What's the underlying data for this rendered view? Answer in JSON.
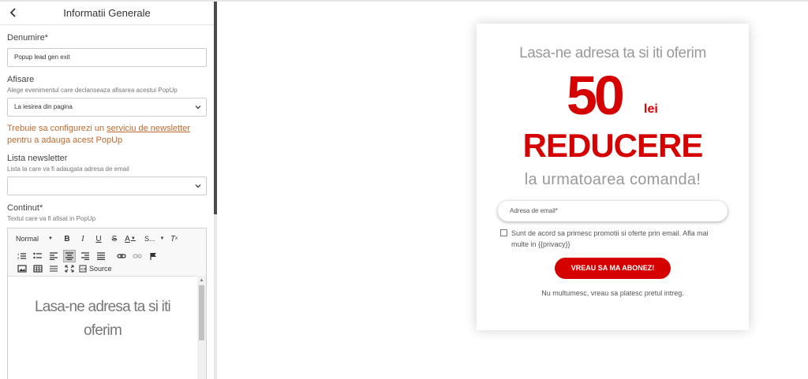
{
  "panel": {
    "title": "Informatii Generale",
    "back_icon": "chevron-left-icon",
    "name_label": "Denumire*",
    "name_value": "Popup lead gen exit",
    "display_label": "Afisare",
    "display_hint": "Alege evenimentul care declanseaza afisarea acestui PopUp",
    "display_value": "La iesirea din pagina",
    "warning_prefix": "Trebuie sa configurezi un ",
    "warning_link": "serviciu de newsletter",
    "warning_suffix": " pentru a adauga acest PopUp",
    "newsletter_label": "Lista newsletter",
    "newsletter_hint": "Lista la care va fi adaugata adresa de email",
    "newsletter_value": "",
    "content_label": "Continut*",
    "content_hint": "Textul care va fi afisat in PopUp",
    "accent_color": "#c0692e"
  },
  "editor": {
    "format_label": "Normal",
    "size_label": "S...",
    "source_label": "Source",
    "content_text": "Lasa-ne adresa ta si iti oferim"
  },
  "popup": {
    "headline": "Lasa-ne adresa ta si iti oferim",
    "amount": "50",
    "currency": "lei",
    "discount": "REDUCERE",
    "subline": "la urmatoarea comanda!",
    "email_placeholder": "Adresa de email*",
    "consent": "Sunt de acord sa primesc promotii si oferte prin email. Afla mai multe in {{privacy}}",
    "subscribe_button": "VREAU SA MA ABONEZ!",
    "decline": "Nu multumesc, vreau sa platesc pretul intreg.",
    "brand_color": "#d50000"
  }
}
